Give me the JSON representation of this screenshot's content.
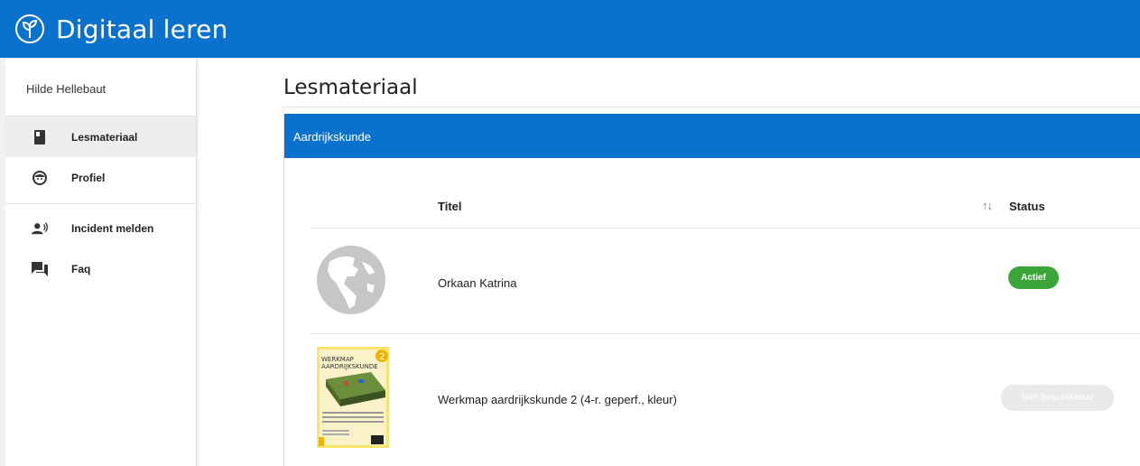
{
  "app": {
    "title": "Digitaal leren",
    "logo_icon": "sprout-circle-icon"
  },
  "sidebar": {
    "user_name": "Hilde Hellebaut",
    "items": [
      {
        "label": "Lesmateriaal",
        "icon": "book-icon",
        "active": true
      },
      {
        "label": "Profiel",
        "icon": "face-icon",
        "active": false
      },
      {
        "label": "Incident melden",
        "icon": "report-person-icon",
        "active": false
      },
      {
        "label": "Faq",
        "icon": "chat-icon",
        "active": false
      }
    ]
  },
  "main": {
    "page_title": "Lesmateriaal",
    "card": {
      "header": "Aardrijkskunde",
      "columns": {
        "title": "Titel",
        "sort_icon": "↑↓",
        "status": "Status"
      },
      "rows": [
        {
          "title": "Orkaan Katrina",
          "thumbnail": "globe-placeholder",
          "status": "Actief",
          "status_color": "#3aa63a"
        },
        {
          "title": "Werkmap aardrijkskunde 2 (4-r. geperf., kleur)",
          "thumbnail": "book-cover",
          "status": "Niet beschikbaar",
          "status_color": "#e9e9e9",
          "cover_title_line1": "WERKMAP",
          "cover_title_line2": "AARDRIJKSKUNDE",
          "cover_number": "2"
        }
      ]
    }
  },
  "colors": {
    "brand": "#0a72cd",
    "active_badge": "#3aa63a",
    "disabled_badge": "#e9e9e9"
  }
}
